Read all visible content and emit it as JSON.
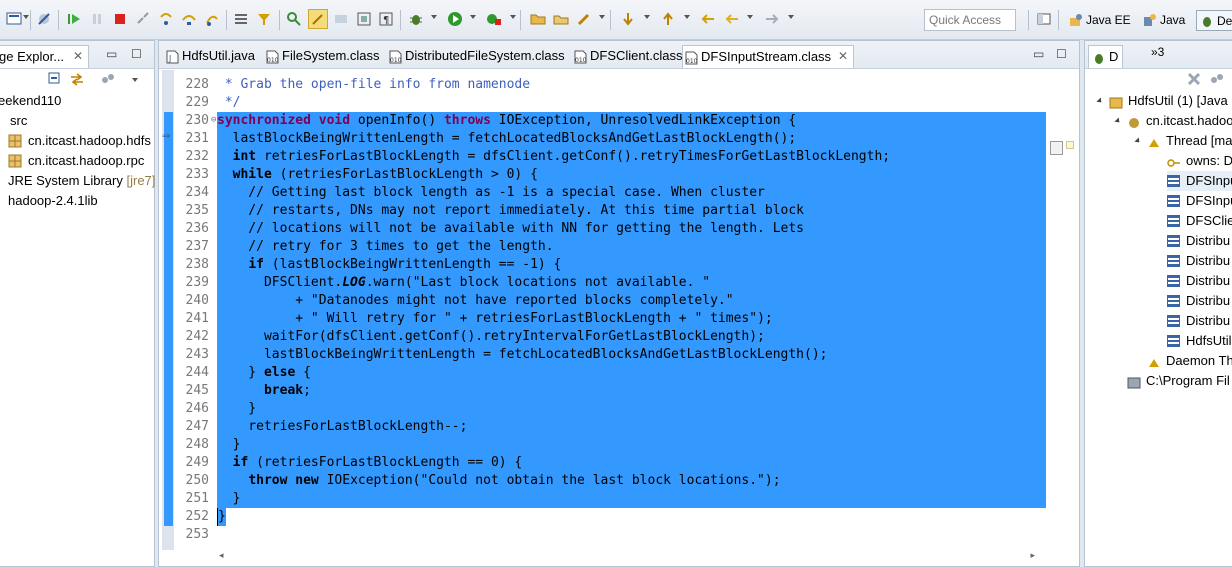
{
  "toolbar": {
    "quick_access": "Quick Access",
    "perspectives": [
      "Java EE",
      "Java",
      "De"
    ]
  },
  "explorer": {
    "tab_label": "ge Explor...",
    "items": [
      "eekend110",
      "src",
      "cn.itcast.hadoop.hdfs",
      "cn.itcast.hadoop.rpc",
      "JRE System Library",
      "[jre7]",
      "hadoop-2.4.1lib"
    ]
  },
  "editor": {
    "tabs": [
      "HdfsUtil.java",
      "FileSystem.class",
      "DistributedFileSystem.class",
      "DFSClient.class",
      "DFSInputStream.class"
    ],
    "line_numbers": [
      "228",
      "229",
      "230",
      "231",
      "232",
      "233",
      "234",
      "235",
      "236",
      "237",
      "238",
      "239",
      "240",
      "241",
      "242",
      "243",
      "244",
      "245",
      "246",
      "247",
      "248",
      "249",
      "250",
      "251",
      "252",
      "253"
    ],
    "lines": [
      [
        {
          "t": " * Grab the open-file info from namenode",
          "c": "cm"
        }
      ],
      [
        {
          "t": " */",
          "c": "cm"
        }
      ],
      [
        {
          "t": "synchronized",
          "c": "kw"
        },
        {
          "t": " "
        },
        {
          "t": "void",
          "c": "kw"
        },
        {
          "t": " openInfo() "
        },
        {
          "t": "throws",
          "c": "kw"
        },
        {
          "t": " IOException, UnresolvedLinkException {"
        }
      ],
      [
        {
          "t": "  lastBlockBeingWrittenLength = fetchLocatedBlocksAndGetLastBlockLength();"
        }
      ],
      [
        {
          "t": "  "
        },
        {
          "t": "int",
          "c": "kw"
        },
        {
          "t": " retriesForLastBlockLength = dfsClient.getConf().retryTimesForGetLastBlockLength;"
        }
      ],
      [
        {
          "t": "  "
        },
        {
          "t": "while",
          "c": "kw"
        },
        {
          "t": " (retriesForLastBlockLength > 0) {"
        }
      ],
      [
        {
          "t": "    // Getting last block length as -1 is a special case. When cluster",
          "c": "cm"
        }
      ],
      [
        {
          "t": "    // restarts, DNs may not report immediately. At this time partial block",
          "c": "cm"
        }
      ],
      [
        {
          "t": "    // locations will not be available with NN for getting the length. Lets",
          "c": "cm"
        }
      ],
      [
        {
          "t": "    // retry for 3 times to get the length.",
          "c": "cm"
        }
      ],
      [
        {
          "t": "    "
        },
        {
          "t": "if",
          "c": "kw"
        },
        {
          "t": " (lastBlockBeingWrittenLength == -1) {"
        }
      ],
      [
        {
          "t": "      DFSClient."
        },
        {
          "t": "LOG",
          "c": "it"
        },
        {
          "t": ".warn("
        },
        {
          "t": "\"Last block locations not available. \"",
          "c": "st"
        }
      ],
      [
        {
          "t": "          + "
        },
        {
          "t": "\"Datanodes might not have reported blocks completely.\"",
          "c": "st"
        }
      ],
      [
        {
          "t": "          + "
        },
        {
          "t": "\" Will retry for \"",
          "c": "st"
        },
        {
          "t": " + retriesForLastBlockLength + "
        },
        {
          "t": "\" times\"",
          "c": "st"
        },
        {
          "t": ");"
        }
      ],
      [
        {
          "t": "      waitFor(dfsClient.getConf().retryIntervalForGetLastBlockLength);"
        }
      ],
      [
        {
          "t": "      lastBlockBeingWrittenLength = fetchLocatedBlocksAndGetLastBlockLength();"
        }
      ],
      [
        {
          "t": "    } "
        },
        {
          "t": "else",
          "c": "kw"
        },
        {
          "t": " {"
        }
      ],
      [
        {
          "t": "      "
        },
        {
          "t": "break",
          "c": "kw"
        },
        {
          "t": ";"
        }
      ],
      [
        {
          "t": "    }"
        }
      ],
      [
        {
          "t": "    retriesForLastBlockLength--;"
        }
      ],
      [
        {
          "t": "  }"
        }
      ],
      [
        {
          "t": "  "
        },
        {
          "t": "if",
          "c": "kw"
        },
        {
          "t": " (retriesForLastBlockLength == 0) {"
        }
      ],
      [
        {
          "t": "    "
        },
        {
          "t": "throw",
          "c": "kw"
        },
        {
          "t": " "
        },
        {
          "t": "new",
          "c": "kw"
        },
        {
          "t": " IOException("
        },
        {
          "t": "\"Could not obtain the last block locations.\"",
          "c": "st"
        },
        {
          "t": ");"
        }
      ],
      [
        {
          "t": "  }"
        }
      ],
      [
        {
          "t": "}"
        }
      ],
      [
        {
          "t": ""
        }
      ]
    ]
  },
  "debug": {
    "tab_label": "D",
    "overflow": "»3",
    "items": [
      "HdfsUtil (1) [Java",
      "cn.itcast.hadoo",
      "Thread [ma",
      "owns: D",
      "DFSInpu",
      "DFSInpu",
      "DFSClier",
      "Distribu",
      "Distribu",
      "Distribu",
      "Distribu",
      "Distribu",
      "HdfsUtil",
      "Daemon Th",
      "C:\\Program Fil"
    ]
  }
}
